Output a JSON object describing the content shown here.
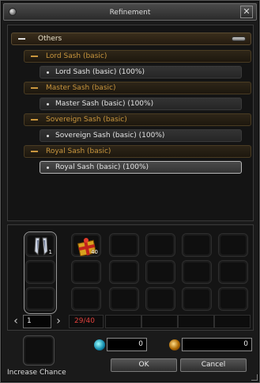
{
  "window": {
    "title": "Refinement",
    "close_label": "✕"
  },
  "tree": {
    "root_label": "Others",
    "categories": [
      {
        "label": "Lord Sash (basic)",
        "item": "Lord Sash (basic) (100%)",
        "selected": false
      },
      {
        "label": "Master Sash (basic)",
        "item": "Master Sash (basic) (100%)",
        "selected": false
      },
      {
        "label": "Sovereign Sash (basic)",
        "item": "Sovereign Sash (basic) (100%)",
        "selected": false
      },
      {
        "label": "Royal Sash (basic)",
        "item": "Royal Sash (basic) (100%)",
        "selected": true
      }
    ]
  },
  "inventory": {
    "slot1": {
      "icon": "sash-icon",
      "count": "1"
    },
    "slot2": {
      "icon": "gift-box-icon",
      "count": "40"
    }
  },
  "pager": {
    "page": "1",
    "count_text": "29/40"
  },
  "costs": {
    "gem_value": "0",
    "zen_value": "0"
  },
  "chance": {
    "label": "Increase Chance"
  },
  "buttons": {
    "ok": "OK",
    "cancel": "Cancel"
  },
  "colors": {
    "category_text": "#c9963e",
    "count_text": "#e0403c",
    "selected_border": "#b5b5b5"
  }
}
